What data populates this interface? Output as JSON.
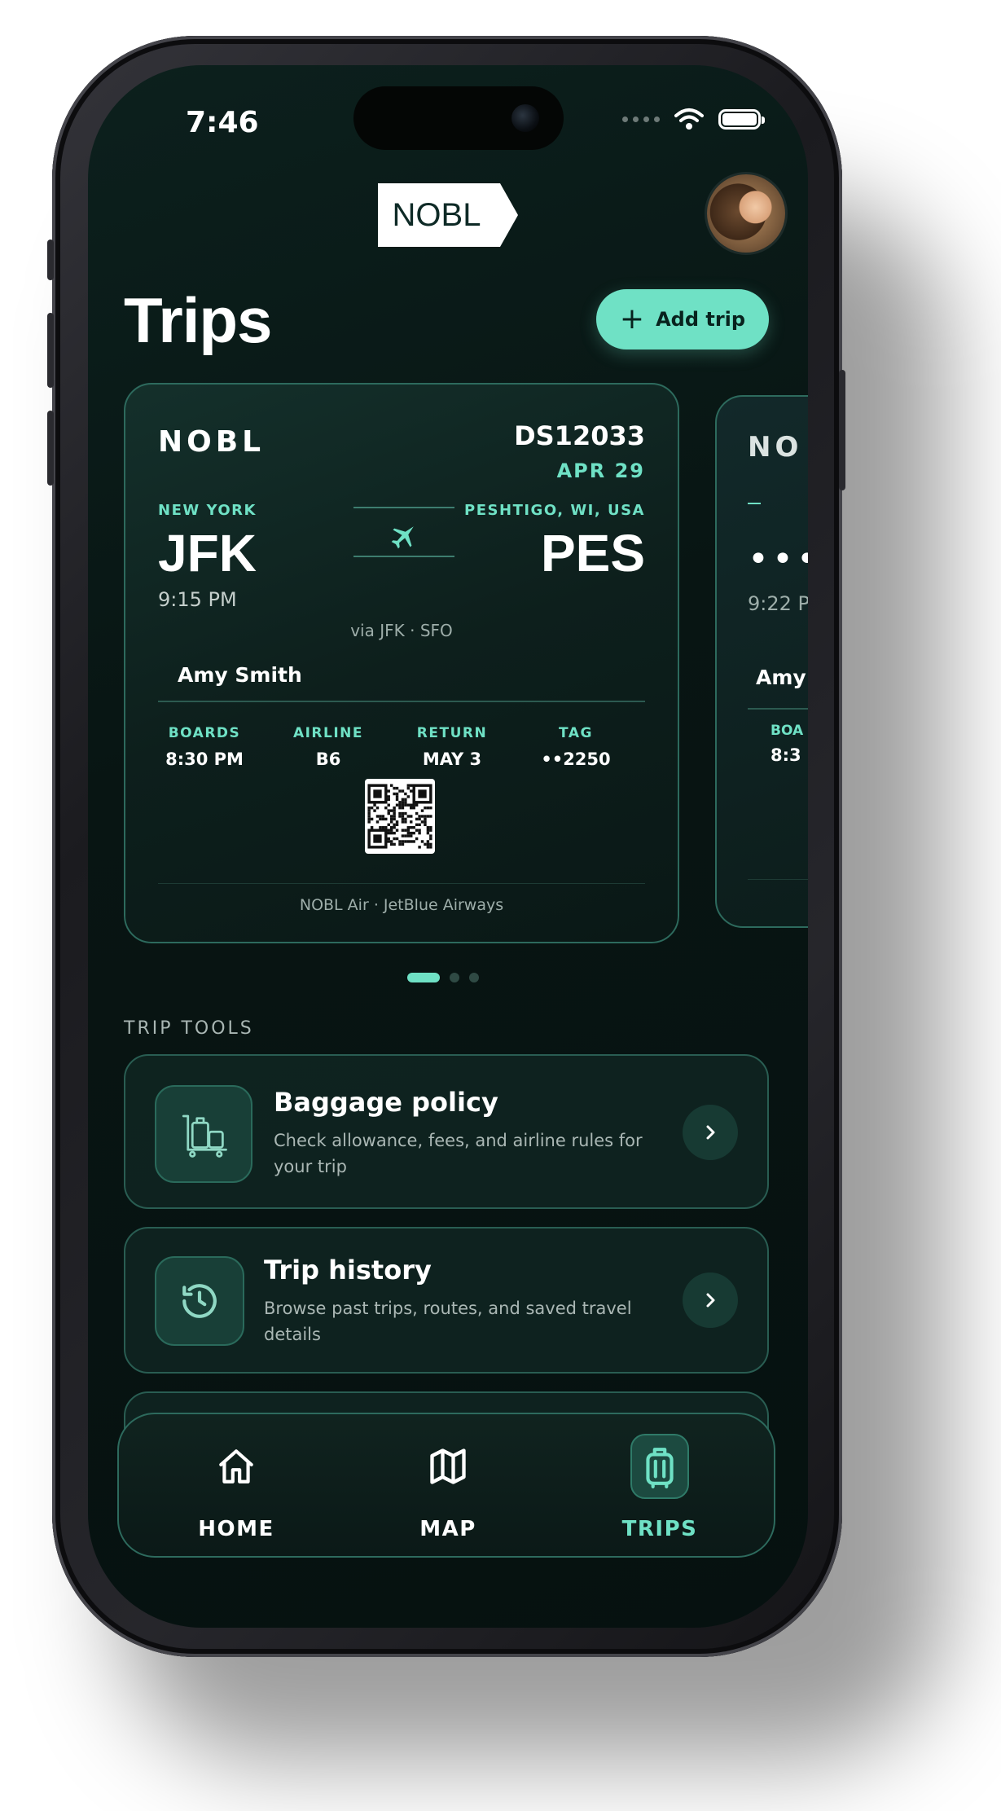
{
  "status_bar": {
    "time": "7:46"
  },
  "header": {
    "logo_text": "NOBL",
    "avatar_alt": "user avatar"
  },
  "page": {
    "title": "Trips",
    "add_button_label": "Add trip"
  },
  "boarding_pass": {
    "brand": "NOBL",
    "flight_code": "DS12033",
    "date": "APR 29",
    "origin": {
      "city": "NEW YORK",
      "code": "JFK",
      "time": "9:15 PM"
    },
    "destination": {
      "city": "PESHTIGO, WI, USA",
      "code": "PES"
    },
    "via": "via JFK · SFO",
    "passenger": "Amy Smith",
    "details": [
      {
        "label": "BOARDS",
        "value": "8:30 PM"
      },
      {
        "label": "AIRLINE",
        "value": "B6"
      },
      {
        "label": "RETURN",
        "value": "MAY 3"
      },
      {
        "label": "TAG",
        "value": "••2250"
      }
    ],
    "footer": "NOBL Air · JetBlue Airways"
  },
  "next_pass_peek": {
    "brand": "NO",
    "code": "•••",
    "time": "9:22 P",
    "passenger": "Amy",
    "detail_label": "BOA",
    "detail_value": "8:3"
  },
  "carousel": {
    "pages": 3,
    "active": 1
  },
  "trip_tools": {
    "section_title": "TRIP TOOLS",
    "items": [
      {
        "title": "Baggage policy",
        "description": "Check allowance, fees, and airline rules for your trip",
        "icon": "luggage-cart-icon"
      },
      {
        "title": "Trip history",
        "description": "Browse past trips, routes, and saved travel details",
        "icon": "history-icon"
      }
    ]
  },
  "nav": {
    "items": [
      {
        "label": "HOME",
        "icon": "home-icon",
        "active": false
      },
      {
        "label": "MAP",
        "icon": "map-icon",
        "active": false
      },
      {
        "label": "TRIPS",
        "icon": "suitcase-icon",
        "active": true
      }
    ]
  },
  "colors": {
    "accent": "#6fe1c5",
    "background": "#081513",
    "card_border": "#2d6a5d"
  }
}
